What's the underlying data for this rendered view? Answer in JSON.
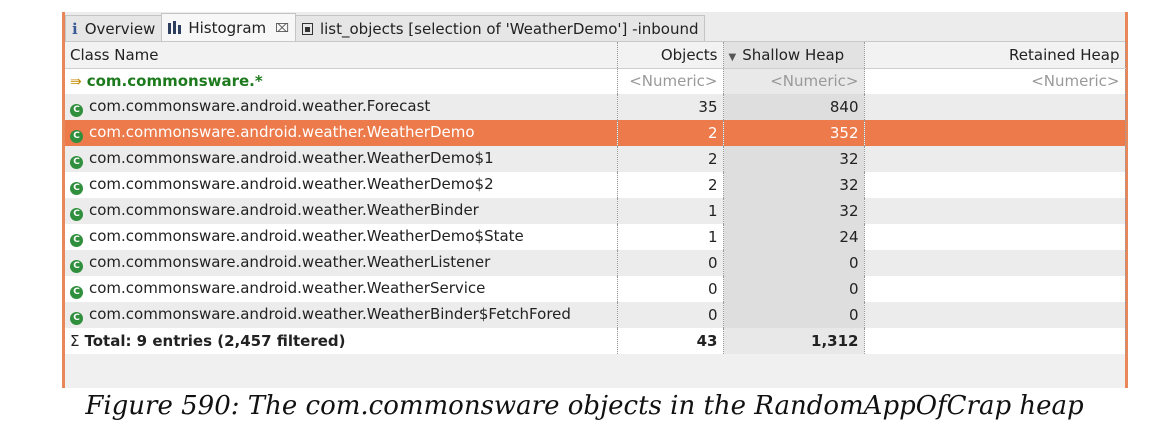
{
  "tabs": [
    {
      "label": "Overview",
      "icon": "info-icon"
    },
    {
      "label": "Histogram",
      "icon": "histogram-icon",
      "close": "⌧"
    },
    {
      "label": "list_objects [selection of 'WeatherDemo'] -inbound",
      "icon": "document-icon"
    }
  ],
  "columns": {
    "class_name": "Class Name",
    "objects": "Objects",
    "shallow_heap": "Shallow Heap",
    "retained_heap": "Retained Heap"
  },
  "filter_row": {
    "class_name": "com.commonsware.*",
    "objects": "<Numeric>",
    "shallow_heap": "<Numeric>",
    "retained_heap": "<Numeric>"
  },
  "rows": [
    {
      "class_name": "com.commonsware.android.weather.Forecast",
      "objects": "35",
      "shallow_heap": "840",
      "retained_heap": ""
    },
    {
      "class_name": "com.commonsware.android.weather.WeatherDemo",
      "objects": "2",
      "shallow_heap": "352",
      "retained_heap": ""
    },
    {
      "class_name": "com.commonsware.android.weather.WeatherDemo$1",
      "objects": "2",
      "shallow_heap": "32",
      "retained_heap": ""
    },
    {
      "class_name": "com.commonsware.android.weather.WeatherDemo$2",
      "objects": "2",
      "shallow_heap": "32",
      "retained_heap": ""
    },
    {
      "class_name": "com.commonsware.android.weather.WeatherBinder",
      "objects": "1",
      "shallow_heap": "32",
      "retained_heap": ""
    },
    {
      "class_name": "com.commonsware.android.weather.WeatherDemo$State",
      "objects": "1",
      "shallow_heap": "24",
      "retained_heap": ""
    },
    {
      "class_name": "com.commonsware.android.weather.WeatherListener",
      "objects": "0",
      "shallow_heap": "0",
      "retained_heap": ""
    },
    {
      "class_name": "com.commonsware.android.weather.WeatherService",
      "objects": "0",
      "shallow_heap": "0",
      "retained_heap": ""
    },
    {
      "class_name": "com.commonsware.android.weather.WeatherBinder$FetchFored",
      "objects": "0",
      "shallow_heap": "0",
      "retained_heap": ""
    }
  ],
  "total_row": {
    "label": "Total: 9 entries (2,457 filtered)",
    "objects": "43",
    "shallow_heap": "1,312",
    "retained_heap": ""
  },
  "caption": "Figure 590: The com.commonsware objects in the RandomAppOfCrap heap",
  "colors": {
    "selection": "#ec7a4b",
    "class_icon": "#2f8f3c",
    "filter_text": "#1d7a1d"
  }
}
